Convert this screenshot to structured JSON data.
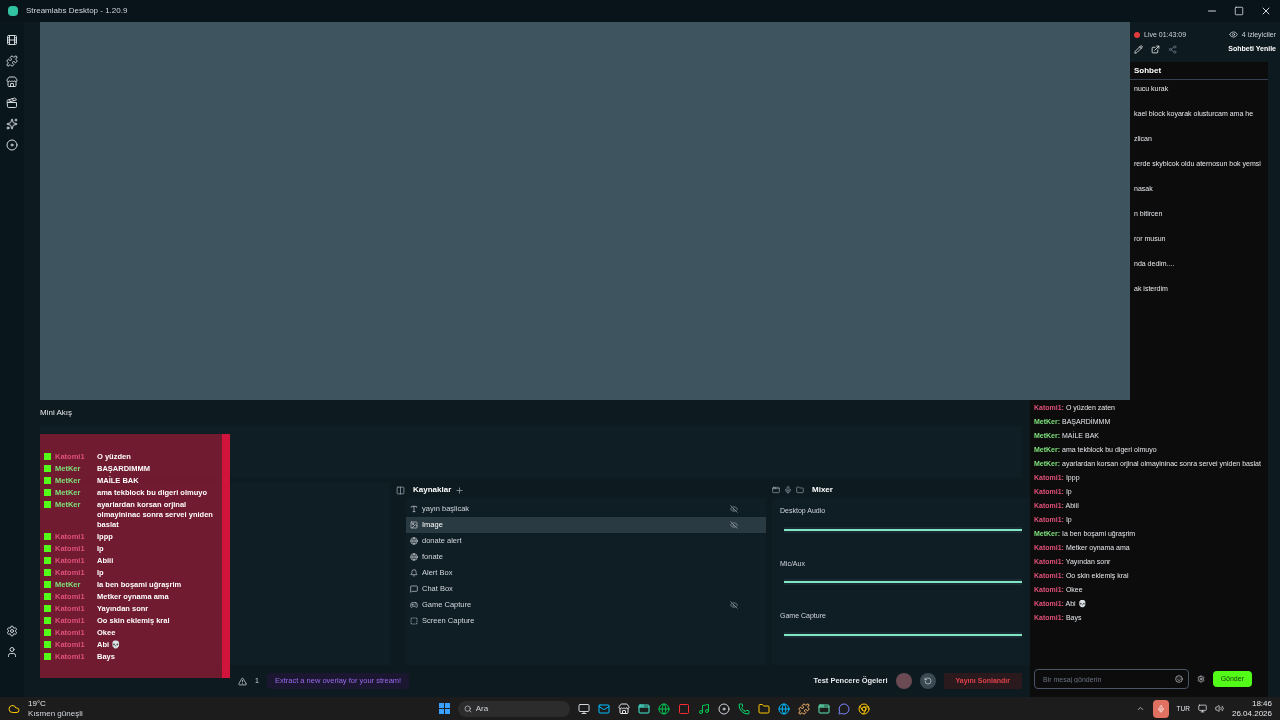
{
  "window": {
    "title": "Streamlabs Desktop - 1.20.9"
  },
  "stream_status": {
    "live": "Live 01:43:09",
    "viewers": "4 izleyiciler",
    "refresh_chat": "Sohbeti Yenile"
  },
  "chat": {
    "title": "Sohbet",
    "cut_lines": [
      "nucu kurak",
      "kael block koyarak olusturcam ama he",
      "zlican",
      "rerde skyblcok oldu aternosun bok yemsi",
      "nasak",
      "n bitircen",
      "ror musun",
      "nda dedim....",
      "ak isterdim"
    ],
    "messages": [
      {
        "user": "Katomi1:",
        "text": "O yüzden zaten",
        "color": "#e0517a"
      },
      {
        "user": "MetKer:",
        "text": "BAŞARDİMMM",
        "color": "#7ee07a"
      },
      {
        "user": "MetKer:",
        "text": "MAİLE BAK",
        "color": "#7ee07a"
      },
      {
        "user": "MetKer:",
        "text": "ama tekblock bu digeri olmuyo",
        "color": "#7ee07a"
      },
      {
        "user": "MetKer:",
        "text": "ayarlardan korsan orjinal olmayininac sonra servei yniden baslat",
        "color": "#7ee07a"
      },
      {
        "user": "Katomi1:",
        "text": "Ippp",
        "color": "#e0517a"
      },
      {
        "user": "Katomi1:",
        "text": "Ip",
        "color": "#e0517a"
      },
      {
        "user": "Katomi1:",
        "text": "Abiii",
        "color": "#e0517a"
      },
      {
        "user": "Katomi1:",
        "text": "Ip",
        "color": "#e0517a"
      },
      {
        "user": "MetKer:",
        "text": "Ia ben boşami uğraşrim",
        "color": "#7ee07a"
      },
      {
        "user": "Katomi1:",
        "text": "Metker oynama ama",
        "color": "#e0517a"
      },
      {
        "user": "Katomi1:",
        "text": "Yayından sonr",
        "color": "#e0517a"
      },
      {
        "user": "Katomi1:",
        "text": "Oo skin eklemiş kral",
        "color": "#e0517a"
      },
      {
        "user": "Katomi1:",
        "text": "Okee",
        "color": "#e0517a"
      },
      {
        "user": "Katomi1:",
        "text": "Abi 💀",
        "color": "#e0517a"
      },
      {
        "user": "Katomi1:",
        "text": "Bays",
        "color": "#e0517a"
      }
    ],
    "input": {
      "placeholder": "Bir mesaj gönderin"
    },
    "send": "Gönder"
  },
  "mini_feed": {
    "title": "Mini Akış"
  },
  "sources": {
    "title": "Kaynaklar",
    "items": [
      {
        "name": "yayın başlicak",
        "kind": "text",
        "selected": false,
        "hidden": true
      },
      {
        "name": "Image",
        "kind": "image",
        "selected": true,
        "hidden": true
      },
      {
        "name": "donate alert",
        "kind": "browser",
        "selected": false,
        "hidden": false
      },
      {
        "name": "fonate",
        "kind": "browser",
        "selected": false,
        "hidden": false
      },
      {
        "name": "Alert Box",
        "kind": "alert",
        "selected": false,
        "hidden": false
      },
      {
        "name": "Chat Box",
        "kind": "chat",
        "selected": false,
        "hidden": false
      },
      {
        "name": "Game Capture",
        "kind": "game",
        "selected": false,
        "hidden": true
      },
      {
        "name": "Screen Capture",
        "kind": "screen",
        "selected": false,
        "hidden": false
      }
    ]
  },
  "mixer": {
    "title": "Mixer",
    "channels": [
      {
        "name": "Desktop Audio",
        "level": 1
      },
      {
        "name": "Mic/Aux",
        "level": 1
      },
      {
        "name": "Game Capture",
        "level": 1
      }
    ]
  },
  "footer": {
    "notice_count": "1",
    "notice": "Extract a new overlay for your stream!",
    "test_label": "Test Pencere Ögeleri",
    "end_stream": "Yayını Sonlandır"
  },
  "overlay_chat": {
    "messages": [
      {
        "user": "Katomi1",
        "text": "O yüzden",
        "color": "#e0517a"
      },
      {
        "user": "MetKer",
        "text": "BAŞARDIMMM",
        "color": "#7ee07a"
      },
      {
        "user": "MetKer",
        "text": "MAİLE BAK",
        "color": "#7ee07a"
      },
      {
        "user": "MetKer",
        "text": "ama tekblock bu digeri olmuyo",
        "color": "#7ee07a"
      },
      {
        "user": "MetKer",
        "text": "ayarlardan korsan orjinal olmayininac sonra servei yniden baslat",
        "color": "#7ee07a"
      },
      {
        "user": "Katomi1",
        "text": "Ippp",
        "color": "#e0517a"
      },
      {
        "user": "Katomi1",
        "text": "Ip",
        "color": "#e0517a"
      },
      {
        "user": "Katomi1",
        "text": "Abiii",
        "color": "#e0517a"
      },
      {
        "user": "Katomi1",
        "text": "Ip",
        "color": "#e0517a"
      },
      {
        "user": "MetKer",
        "text": "Ia ben boşami uğraşrim",
        "color": "#7ee07a"
      },
      {
        "user": "Katomi1",
        "text": "Metker oynama ama",
        "color": "#e0517a"
      },
      {
        "user": "Katomi1",
        "text": "Yayından sonr",
        "color": "#e0517a"
      },
      {
        "user": "Katomi1",
        "text": "Oo skin eklemiş kral",
        "color": "#e0517a"
      },
      {
        "user": "Katomi1",
        "text": "Okee",
        "color": "#e0517a"
      },
      {
        "user": "Katomi1",
        "text": "Abi 💀",
        "color": "#e0517a"
      },
      {
        "user": "Katomi1",
        "text": "Bays",
        "color": "#e0517a"
      }
    ]
  },
  "taskbar": {
    "weather_temp": "19°C",
    "weather_text": "Kısmen güneşli",
    "search": {
      "placeholder": "Ara"
    },
    "language": "TUR",
    "time": "18:46",
    "date": "26.04.2026"
  }
}
